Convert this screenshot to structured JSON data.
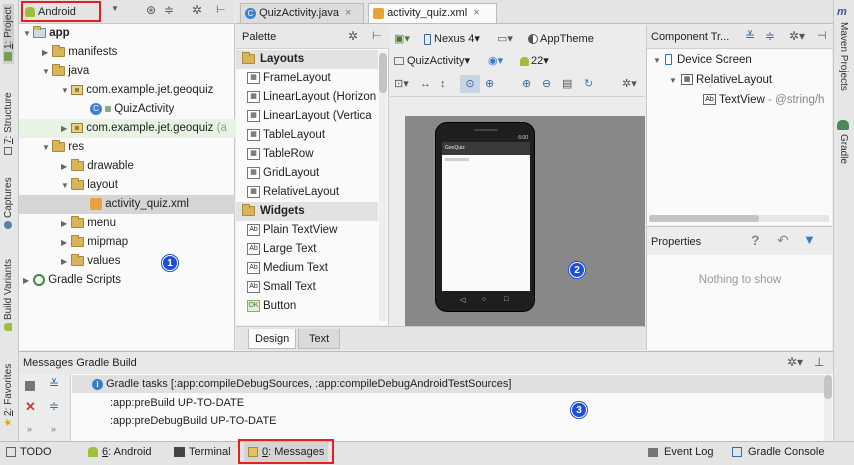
{
  "left_strip": {
    "tabs": [
      {
        "number": "1",
        "label": ": Project"
      },
      {
        "number": "7",
        "label": ": Structure"
      },
      {
        "number": "",
        "label": "Captures"
      },
      {
        "number": "",
        "label": "Build Variants"
      },
      {
        "number": "2",
        "label": ": Favorites"
      }
    ]
  },
  "right_strip": {
    "tabs": [
      {
        "label": "Maven Projects"
      },
      {
        "label": "Gradle"
      }
    ]
  },
  "project_panel": {
    "view_selector": "Android",
    "tree": [
      {
        "label": "app",
        "level": 0,
        "bold": true,
        "icon": "module-folder-icon",
        "expanded": true
      },
      {
        "label": "manifests",
        "level": 1,
        "icon": "folder-icon",
        "expanded": false
      },
      {
        "label": "java",
        "level": 1,
        "icon": "folder-icon",
        "expanded": true
      },
      {
        "label": "com.example.jet.geoquiz",
        "level": 2,
        "icon": "package-icon",
        "expanded": true
      },
      {
        "label": "QuizActivity",
        "level": 3,
        "icon": "class-icon"
      },
      {
        "label": "com.example.jet.geoquiz",
        "suffix": "(a",
        "level": 2,
        "icon": "package-icon",
        "expanded": false
      },
      {
        "label": "res",
        "level": 1,
        "icon": "folder-icon",
        "expanded": true
      },
      {
        "label": "drawable",
        "level": 2,
        "icon": "folder-icon",
        "expanded": false
      },
      {
        "label": "layout",
        "level": 2,
        "icon": "folder-icon",
        "expanded": true
      },
      {
        "label": "activity_quiz.xml",
        "level": 3,
        "icon": "layout-xml-icon",
        "selected": true
      },
      {
        "label": "menu",
        "level": 2,
        "icon": "folder-icon",
        "expanded": false
      },
      {
        "label": "mipmap",
        "level": 2,
        "icon": "folder-icon",
        "expanded": false
      },
      {
        "label": "values",
        "level": 2,
        "icon": "folder-icon",
        "expanded": false
      },
      {
        "label": "Gradle Scripts",
        "level": 0,
        "icon": "gradle-icon",
        "expanded": false
      }
    ]
  },
  "editor_tabs": [
    {
      "label": "QuizActivity.java",
      "active": false
    },
    {
      "label": "activity_quiz.xml",
      "active": true
    }
  ],
  "palette": {
    "title": "Palette",
    "items": [
      {
        "label": "Layouts",
        "header": true
      },
      {
        "label": "FrameLayout"
      },
      {
        "label": "LinearLayout (Horizon"
      },
      {
        "label": "LinearLayout (Vertica"
      },
      {
        "label": "TableLayout"
      },
      {
        "label": "TableRow"
      },
      {
        "label": "GridLayout"
      },
      {
        "label": "RelativeLayout"
      },
      {
        "label": "Widgets",
        "header": true
      },
      {
        "label": "Plain TextView",
        "ab": true
      },
      {
        "label": "Large Text",
        "ab": true
      },
      {
        "label": "Medium Text",
        "ab": true
      },
      {
        "label": "Small Text",
        "ab": true
      },
      {
        "label": "Button",
        "ok": true
      }
    ]
  },
  "design_toolbar": {
    "device": "Nexus 4",
    "theme": "AppTheme",
    "activity": "QuizActivity",
    "api": "22"
  },
  "design_tabs": [
    {
      "label": "Design",
      "active": true
    },
    {
      "label": "Text",
      "active": false
    }
  ],
  "phone_preview": {
    "app_name": "GeoQuiz",
    "status_time": "6:00"
  },
  "component_tree": {
    "title": "Component Tr...",
    "items": [
      {
        "label": "Device Screen",
        "level": 0
      },
      {
        "label": "RelativeLayout",
        "level": 1
      },
      {
        "label": "TextView",
        "suffix": "- @string/h",
        "level": 2
      }
    ]
  },
  "properties": {
    "title": "Properties",
    "empty_text": "Nothing to show"
  },
  "messages": {
    "title": "Messages Gradle Build",
    "lines": [
      {
        "text": "Gradle tasks [:app:compileDebugSources, :app:compileDebugAndroidTestSources]",
        "info": true
      },
      {
        "text": ":app:preBuild UP-TO-DATE",
        "info": false
      },
      {
        "text": ":app:preDebugBuild UP-TO-DATE",
        "info": false
      }
    ]
  },
  "status_bar": {
    "left": [
      {
        "label": "TODO"
      },
      {
        "prefix": "6",
        "label": ": Android"
      },
      {
        "label": "Terminal"
      },
      {
        "prefix": "0",
        "label": ": Messages"
      }
    ],
    "right": [
      {
        "label": "Event Log"
      },
      {
        "label": "Gradle Console"
      }
    ]
  },
  "badges": [
    "1",
    "2",
    "3"
  ],
  "colors": {
    "highlight_box": "#e32020",
    "badge": "#1f4fd6",
    "selection": "#d5d5d5",
    "android_green": "#9fbf3b"
  }
}
